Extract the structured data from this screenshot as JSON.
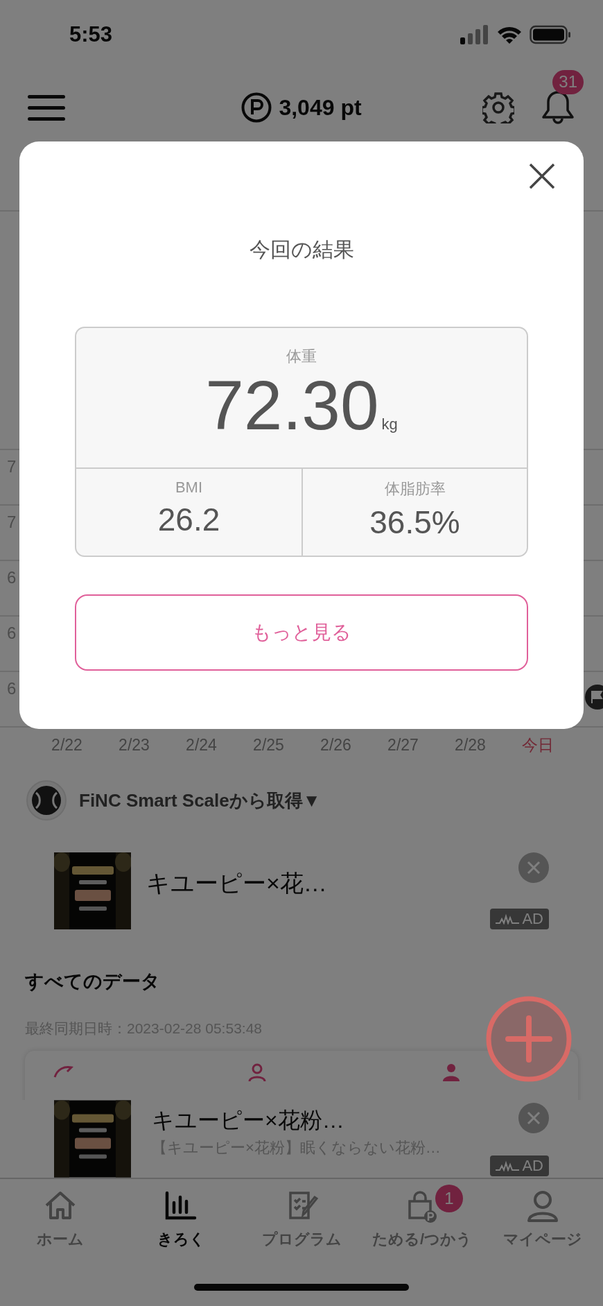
{
  "status_bar": {
    "time": "5:53"
  },
  "header": {
    "points": "3,049 pt",
    "notification_count": "31"
  },
  "chart": {
    "y_labels": [
      "7",
      "7",
      "6",
      "6",
      "6"
    ],
    "dates": [
      {
        "label": "2/22",
        "today": false
      },
      {
        "label": "2/23",
        "today": false
      },
      {
        "label": "2/24",
        "today": false
      },
      {
        "label": "2/25",
        "today": false
      },
      {
        "label": "2/26",
        "today": false
      },
      {
        "label": "2/27",
        "today": false
      },
      {
        "label": "2/28",
        "today": false
      },
      {
        "label": "今日",
        "today": true
      }
    ]
  },
  "source": {
    "label": "FiNC Smart Scaleから取得▼"
  },
  "ads": [
    {
      "title": "キユーピー×花…",
      "badge": "AD"
    },
    {
      "title": "キユーピー×花粉…",
      "description": "【キユーピー×花粉】眠くならない花粉…",
      "badge": "AD"
    }
  ],
  "all_data": {
    "title": "すべてのデータ",
    "synced": "最終同期日時：2023-02-28 05:53:48"
  },
  "tabs": [
    {
      "label": "ホーム",
      "selected": false
    },
    {
      "label": "きろく",
      "selected": true
    },
    {
      "label": "プログラム",
      "selected": false
    },
    {
      "label": "ためる/つかう",
      "selected": false,
      "badge": "1"
    },
    {
      "label": "マイページ",
      "selected": false
    }
  ],
  "modal": {
    "title": "今回の結果",
    "weight": {
      "label": "体重",
      "value": "72.30",
      "unit": "kg"
    },
    "metrics": [
      {
        "label": "BMI",
        "value": "26.2"
      },
      {
        "label": "体脂肪率",
        "value": "36.5%"
      }
    ],
    "button": "もっと見る"
  }
}
